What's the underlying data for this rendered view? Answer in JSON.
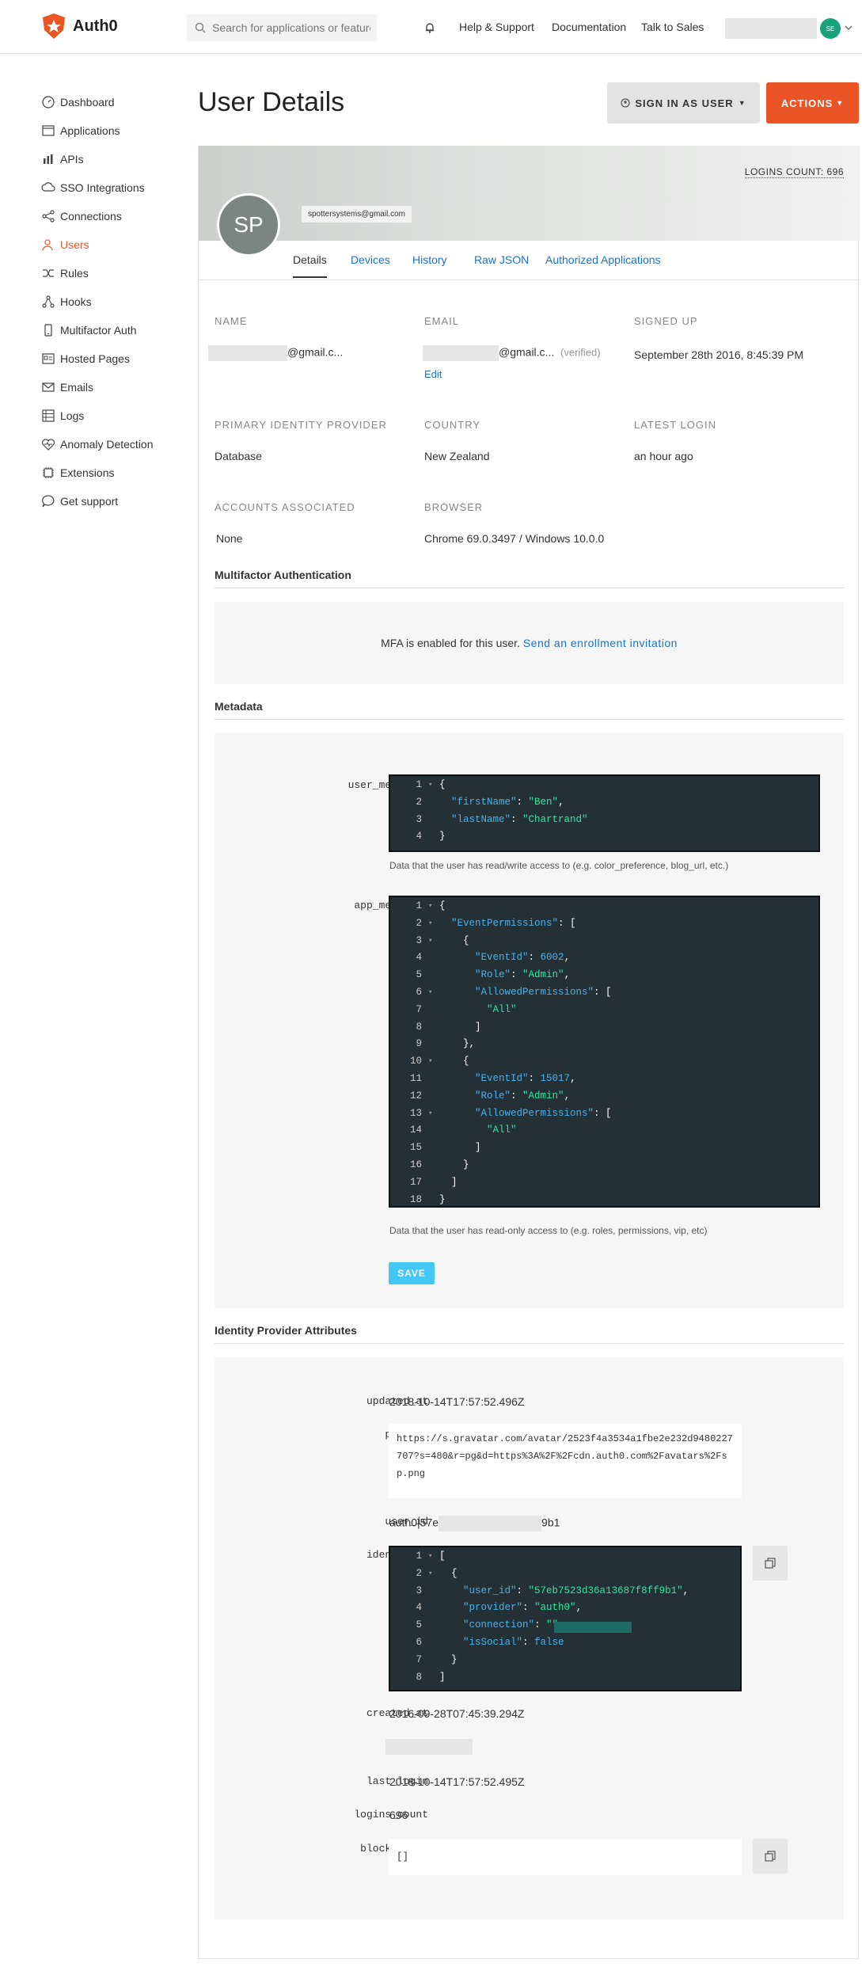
{
  "brand": {
    "name": "Auth0",
    "accent": "#eb5424"
  },
  "header": {
    "search_placeholder": "Search for applications or features",
    "links": [
      "Help & Support",
      "Documentation",
      "Talk to Sales"
    ],
    "avatar_initials": "SE"
  },
  "sidebar": {
    "items": [
      {
        "label": "Dashboard",
        "icon": "dashboard-icon"
      },
      {
        "label": "Applications",
        "icon": "applications-icon"
      },
      {
        "label": "APIs",
        "icon": "apis-icon"
      },
      {
        "label": "SSO Integrations",
        "icon": "sso-icon"
      },
      {
        "label": "Connections",
        "icon": "connections-icon"
      },
      {
        "label": "Users",
        "icon": "users-icon",
        "active": true
      },
      {
        "label": "Rules",
        "icon": "rules-icon"
      },
      {
        "label": "Hooks",
        "icon": "hooks-icon"
      },
      {
        "label": "Multifactor Auth",
        "icon": "mfa-icon"
      },
      {
        "label": "Hosted Pages",
        "icon": "hosted-pages-icon"
      },
      {
        "label": "Emails",
        "icon": "emails-icon"
      },
      {
        "label": "Logs",
        "icon": "logs-icon"
      },
      {
        "label": "Anomaly Detection",
        "icon": "anomaly-icon"
      },
      {
        "label": "Extensions",
        "icon": "extensions-icon"
      },
      {
        "label": "Get support",
        "icon": "support-icon"
      }
    ]
  },
  "page": {
    "title": "User Details",
    "sign_in_as_user": "SIGN IN AS USER",
    "actions": "ACTIONS"
  },
  "profile": {
    "logins_count_label": "LOGINS COUNT: 696",
    "initials": "SP",
    "email_tag": "spottersystems@gmail.com"
  },
  "tabs": [
    "Details",
    "Devices",
    "History",
    "Raw JSON",
    "Authorized Applications"
  ],
  "details": {
    "name_label": "NAME",
    "name_value": "@gmail.c...",
    "email_label": "EMAIL",
    "email_value": "@gmail.c...",
    "email_verified": "(verified)",
    "email_edit": "Edit",
    "signed_up_label": "SIGNED UP",
    "signed_up_value": "September 28th 2016, 8:45:39 PM",
    "primary_idp_label": "PRIMARY IDENTITY PROVIDER",
    "primary_idp_value": "Database",
    "country_label": "COUNTRY",
    "country_value": "New Zealand",
    "latest_login_label": "LATEST LOGIN",
    "latest_login_value": "an hour ago",
    "accounts_label": "ACCOUNTS ASSOCIATED",
    "accounts_value": "None",
    "browser_label": "BROWSER",
    "browser_value": "Chrome 69.0.3497 / Windows 10.0.0"
  },
  "mfa": {
    "heading": "Multifactor Authentication",
    "text": "MFA is enabled for this user.",
    "link": "Send an enrollment invitation"
  },
  "metadata": {
    "heading": "Metadata",
    "user_metadata_key": "user_metadata",
    "user_metadata_hint": "Data that the user has read/write access to (e.g. color_preference, blog_url, etc.)",
    "app_metadata_key": "app_metadata",
    "app_metadata_hint": "Data that the user has read-only access to (e.g. roles, permissions, vip, etc)",
    "save": "SAVE"
  },
  "idp": {
    "heading": "Identity Provider Attributes",
    "updated_at_key": "updated_at",
    "updated_at": "2018-10-14T17:57:52.496Z",
    "picture_key": "picture",
    "picture": "https://s.gravatar.com/avatar/2523f4a3534a1fbe2e232d9480227707?s=480&r=pg&d=https%3A%2F%2Fcdn.auth0.com%2Favatars%2Fsp.png",
    "user_id_key": "user_id",
    "user_id_prefix": "auth0|57e",
    "user_id_suffix": "9b1",
    "identities_key": "identities",
    "created_at_key": "created_at",
    "created_at": "2016-09-28T07:45:39.294Z",
    "last_ip_key": "last_ip",
    "last_login_key": "last_login",
    "last_login": "2018-10-14T17:57:52.495Z",
    "logins_count_key": "logins_count",
    "logins_count": "696",
    "blocked_for_key": "blocked_for",
    "blocked_for": "[]"
  },
  "code_user_metadata": [
    "{",
    "  \"firstName\": \"Ben\",",
    "  \"lastName\": \"Chartrand\"",
    "}"
  ],
  "code_app_metadata": [
    "{",
    "  \"EventPermissions\": [",
    "    {",
    "      \"EventId\": 6002,",
    "      \"Role\": \"Admin\",",
    "      \"AllowedPermissions\": [",
    "        \"All\"",
    "      ]",
    "    },",
    "    {",
    "      \"EventId\": 15017,",
    "      \"Role\": \"Admin\",",
    "      \"AllowedPermissions\": [",
    "        \"All\"",
    "      ]",
    "    }",
    "  ]",
    "}"
  ],
  "code_identities": [
    "[",
    "  {",
    "    \"user_id\": \"57eb7523d36a13687f8ff9b1\",",
    "    \"provider\": \"auth0\",",
    "    \"connection\": \"\",",
    "    \"isSocial\": false",
    "  }",
    "]"
  ]
}
